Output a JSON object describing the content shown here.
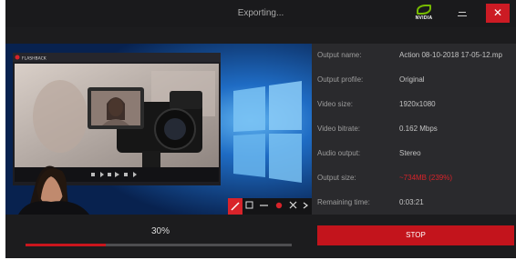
{
  "window": {
    "title": "Exporting...",
    "logo_text": "NVIDIA",
    "minimize_label": "minimize",
    "close_label": "✕"
  },
  "preview": {
    "inner_app_name": "FLASHBACK",
    "toolbar_icons": [
      "pencil-icon",
      "square-icon",
      "line-icon",
      "record-dot-icon",
      "close-icon",
      "chevron-right-icon"
    ]
  },
  "details": [
    {
      "label": "Output name:",
      "value": "Action 08-10-2018 17-05-12.mp"
    },
    {
      "label": "Output profile:",
      "value": "Original"
    },
    {
      "label": "Video size:",
      "value": "1920x1080"
    },
    {
      "label": "Video bitrate:",
      "value": "0.162 Mbps"
    },
    {
      "label": "Audio output:",
      "value": "Stereo"
    },
    {
      "label": "Output size:",
      "value": "~734MB (239%)",
      "highlight": true
    },
    {
      "label": "Remaining time:",
      "value": "0:03:21"
    }
  ],
  "progress": {
    "percent_text": "30%",
    "fraction": 0.3
  },
  "stop_label": "STOP",
  "colors": {
    "accent": "#c3141c",
    "brand": "#76b900",
    "window_bg": "#1c1c1e",
    "panel_bg": "#2a2a2d"
  }
}
